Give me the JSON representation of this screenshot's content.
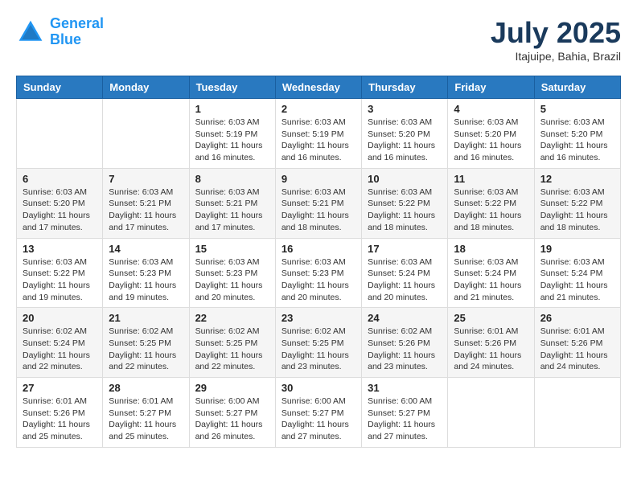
{
  "header": {
    "logo_line1": "General",
    "logo_line2": "Blue",
    "month_title": "July 2025",
    "location": "Itajuipe, Bahia, Brazil"
  },
  "weekdays": [
    "Sunday",
    "Monday",
    "Tuesday",
    "Wednesday",
    "Thursday",
    "Friday",
    "Saturday"
  ],
  "weeks": [
    [
      {
        "day": "",
        "info": ""
      },
      {
        "day": "",
        "info": ""
      },
      {
        "day": "1",
        "info": "Sunrise: 6:03 AM\nSunset: 5:19 PM\nDaylight: 11 hours and 16 minutes."
      },
      {
        "day": "2",
        "info": "Sunrise: 6:03 AM\nSunset: 5:19 PM\nDaylight: 11 hours and 16 minutes."
      },
      {
        "day": "3",
        "info": "Sunrise: 6:03 AM\nSunset: 5:20 PM\nDaylight: 11 hours and 16 minutes."
      },
      {
        "day": "4",
        "info": "Sunrise: 6:03 AM\nSunset: 5:20 PM\nDaylight: 11 hours and 16 minutes."
      },
      {
        "day": "5",
        "info": "Sunrise: 6:03 AM\nSunset: 5:20 PM\nDaylight: 11 hours and 16 minutes."
      }
    ],
    [
      {
        "day": "6",
        "info": "Sunrise: 6:03 AM\nSunset: 5:20 PM\nDaylight: 11 hours and 17 minutes."
      },
      {
        "day": "7",
        "info": "Sunrise: 6:03 AM\nSunset: 5:21 PM\nDaylight: 11 hours and 17 minutes."
      },
      {
        "day": "8",
        "info": "Sunrise: 6:03 AM\nSunset: 5:21 PM\nDaylight: 11 hours and 17 minutes."
      },
      {
        "day": "9",
        "info": "Sunrise: 6:03 AM\nSunset: 5:21 PM\nDaylight: 11 hours and 18 minutes."
      },
      {
        "day": "10",
        "info": "Sunrise: 6:03 AM\nSunset: 5:22 PM\nDaylight: 11 hours and 18 minutes."
      },
      {
        "day": "11",
        "info": "Sunrise: 6:03 AM\nSunset: 5:22 PM\nDaylight: 11 hours and 18 minutes."
      },
      {
        "day": "12",
        "info": "Sunrise: 6:03 AM\nSunset: 5:22 PM\nDaylight: 11 hours and 18 minutes."
      }
    ],
    [
      {
        "day": "13",
        "info": "Sunrise: 6:03 AM\nSunset: 5:22 PM\nDaylight: 11 hours and 19 minutes."
      },
      {
        "day": "14",
        "info": "Sunrise: 6:03 AM\nSunset: 5:23 PM\nDaylight: 11 hours and 19 minutes."
      },
      {
        "day": "15",
        "info": "Sunrise: 6:03 AM\nSunset: 5:23 PM\nDaylight: 11 hours and 20 minutes."
      },
      {
        "day": "16",
        "info": "Sunrise: 6:03 AM\nSunset: 5:23 PM\nDaylight: 11 hours and 20 minutes."
      },
      {
        "day": "17",
        "info": "Sunrise: 6:03 AM\nSunset: 5:24 PM\nDaylight: 11 hours and 20 minutes."
      },
      {
        "day": "18",
        "info": "Sunrise: 6:03 AM\nSunset: 5:24 PM\nDaylight: 11 hours and 21 minutes."
      },
      {
        "day": "19",
        "info": "Sunrise: 6:03 AM\nSunset: 5:24 PM\nDaylight: 11 hours and 21 minutes."
      }
    ],
    [
      {
        "day": "20",
        "info": "Sunrise: 6:02 AM\nSunset: 5:24 PM\nDaylight: 11 hours and 22 minutes."
      },
      {
        "day": "21",
        "info": "Sunrise: 6:02 AM\nSunset: 5:25 PM\nDaylight: 11 hours and 22 minutes."
      },
      {
        "day": "22",
        "info": "Sunrise: 6:02 AM\nSunset: 5:25 PM\nDaylight: 11 hours and 22 minutes."
      },
      {
        "day": "23",
        "info": "Sunrise: 6:02 AM\nSunset: 5:25 PM\nDaylight: 11 hours and 23 minutes."
      },
      {
        "day": "24",
        "info": "Sunrise: 6:02 AM\nSunset: 5:26 PM\nDaylight: 11 hours and 23 minutes."
      },
      {
        "day": "25",
        "info": "Sunrise: 6:01 AM\nSunset: 5:26 PM\nDaylight: 11 hours and 24 minutes."
      },
      {
        "day": "26",
        "info": "Sunrise: 6:01 AM\nSunset: 5:26 PM\nDaylight: 11 hours and 24 minutes."
      }
    ],
    [
      {
        "day": "27",
        "info": "Sunrise: 6:01 AM\nSunset: 5:26 PM\nDaylight: 11 hours and 25 minutes."
      },
      {
        "day": "28",
        "info": "Sunrise: 6:01 AM\nSunset: 5:27 PM\nDaylight: 11 hours and 25 minutes."
      },
      {
        "day": "29",
        "info": "Sunrise: 6:00 AM\nSunset: 5:27 PM\nDaylight: 11 hours and 26 minutes."
      },
      {
        "day": "30",
        "info": "Sunrise: 6:00 AM\nSunset: 5:27 PM\nDaylight: 11 hours and 27 minutes."
      },
      {
        "day": "31",
        "info": "Sunrise: 6:00 AM\nSunset: 5:27 PM\nDaylight: 11 hours and 27 minutes."
      },
      {
        "day": "",
        "info": ""
      },
      {
        "day": "",
        "info": ""
      }
    ]
  ]
}
